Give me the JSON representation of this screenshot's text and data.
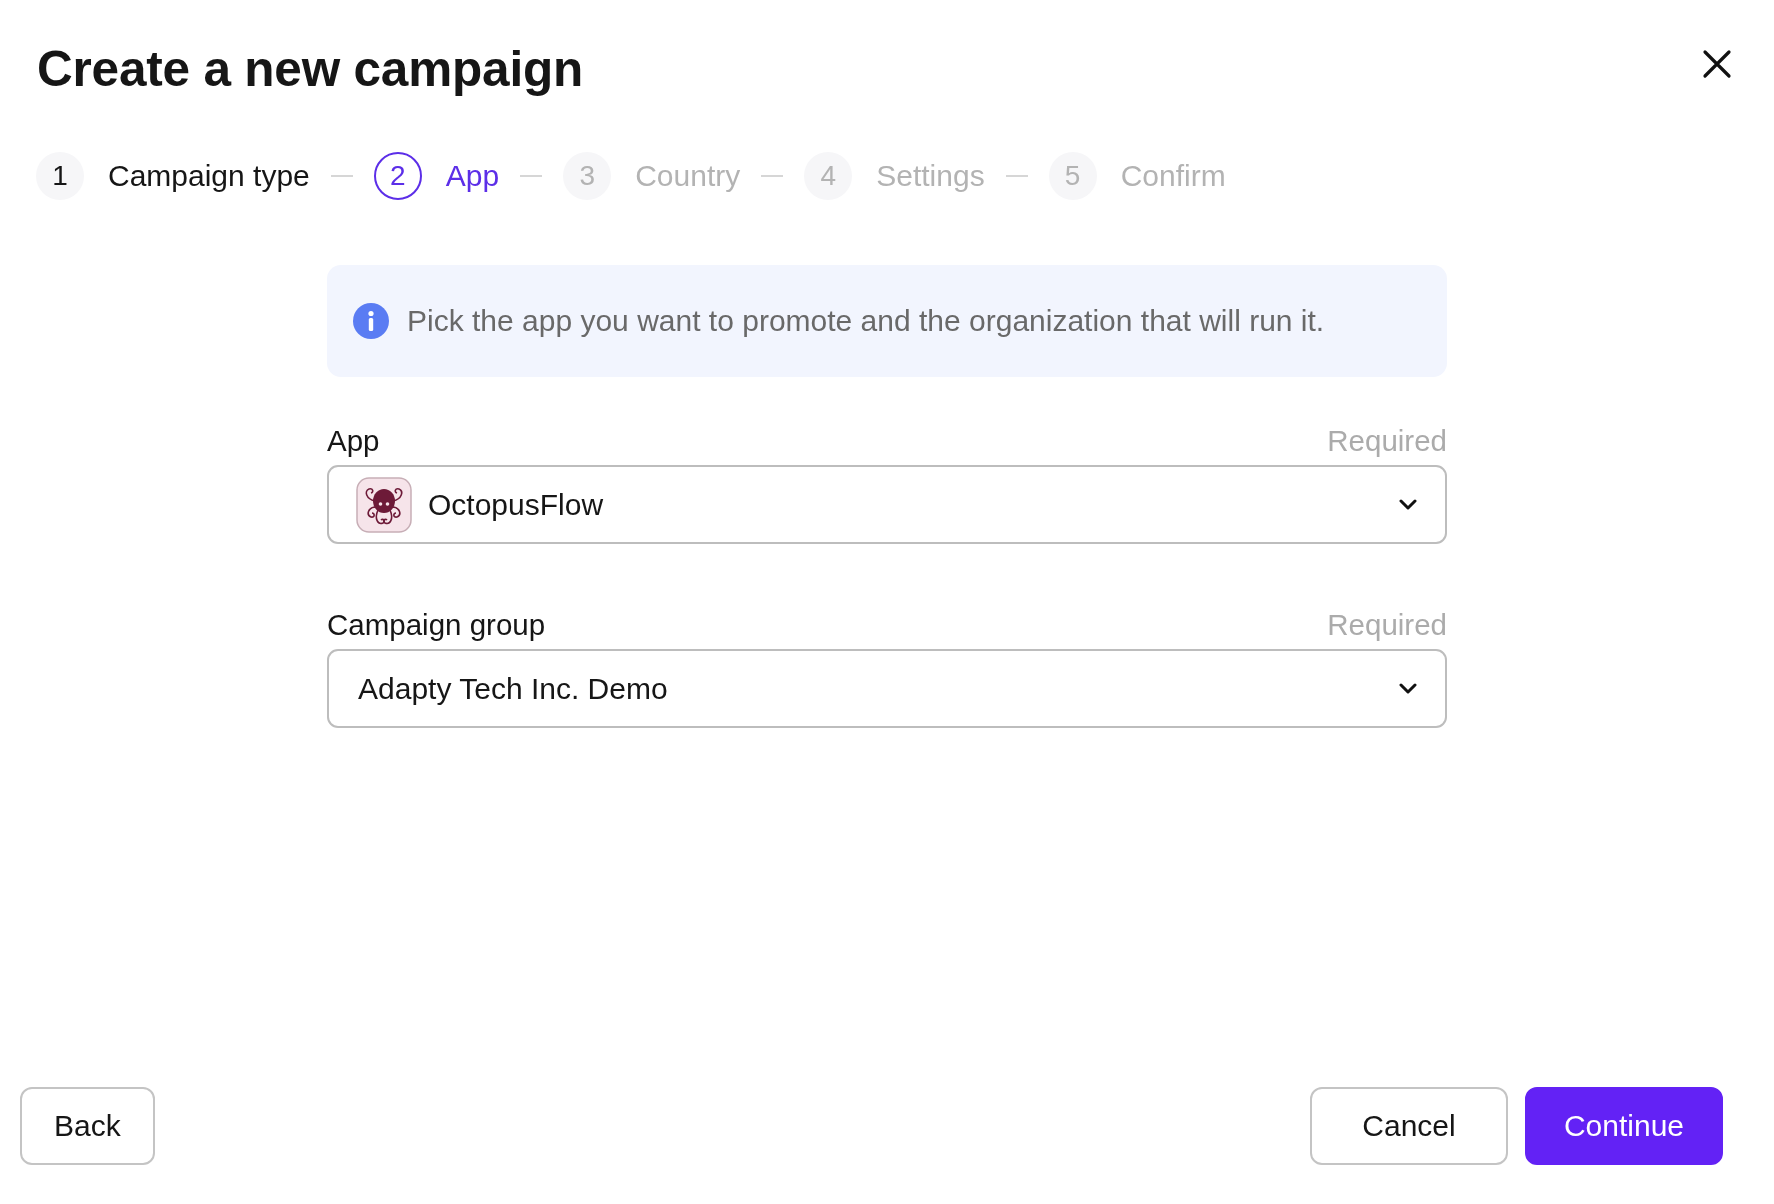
{
  "dialog": {
    "title": "Create a new campaign"
  },
  "steps": [
    {
      "number": "1",
      "label": "Campaign type",
      "selected": false,
      "completed": true
    },
    {
      "number": "2",
      "label": "App",
      "selected": true,
      "completed": false
    },
    {
      "number": "3",
      "label": "Country",
      "selected": false,
      "completed": false
    },
    {
      "number": "4",
      "label": "Settings",
      "selected": false,
      "completed": false
    },
    {
      "number": "5",
      "label": "Confirm",
      "selected": false,
      "completed": false
    }
  ],
  "info": {
    "text": "Pick the app you want to promote and the organization that will run it."
  },
  "fields": [
    {
      "label": "App",
      "note": "Required",
      "value": "OctopusFlow",
      "kind": "app"
    },
    {
      "label": "Campaign group",
      "note": "Required",
      "value": "Adapty Tech Inc. Demo",
      "kind": "plain"
    }
  ],
  "footer": {
    "left_buttons": [
      {
        "label": "Back",
        "kind": "secondary"
      }
    ],
    "right_buttons": [
      {
        "label": "Cancel",
        "kind": "secondary"
      },
      {
        "label": "Continue",
        "kind": "primary"
      }
    ]
  }
}
